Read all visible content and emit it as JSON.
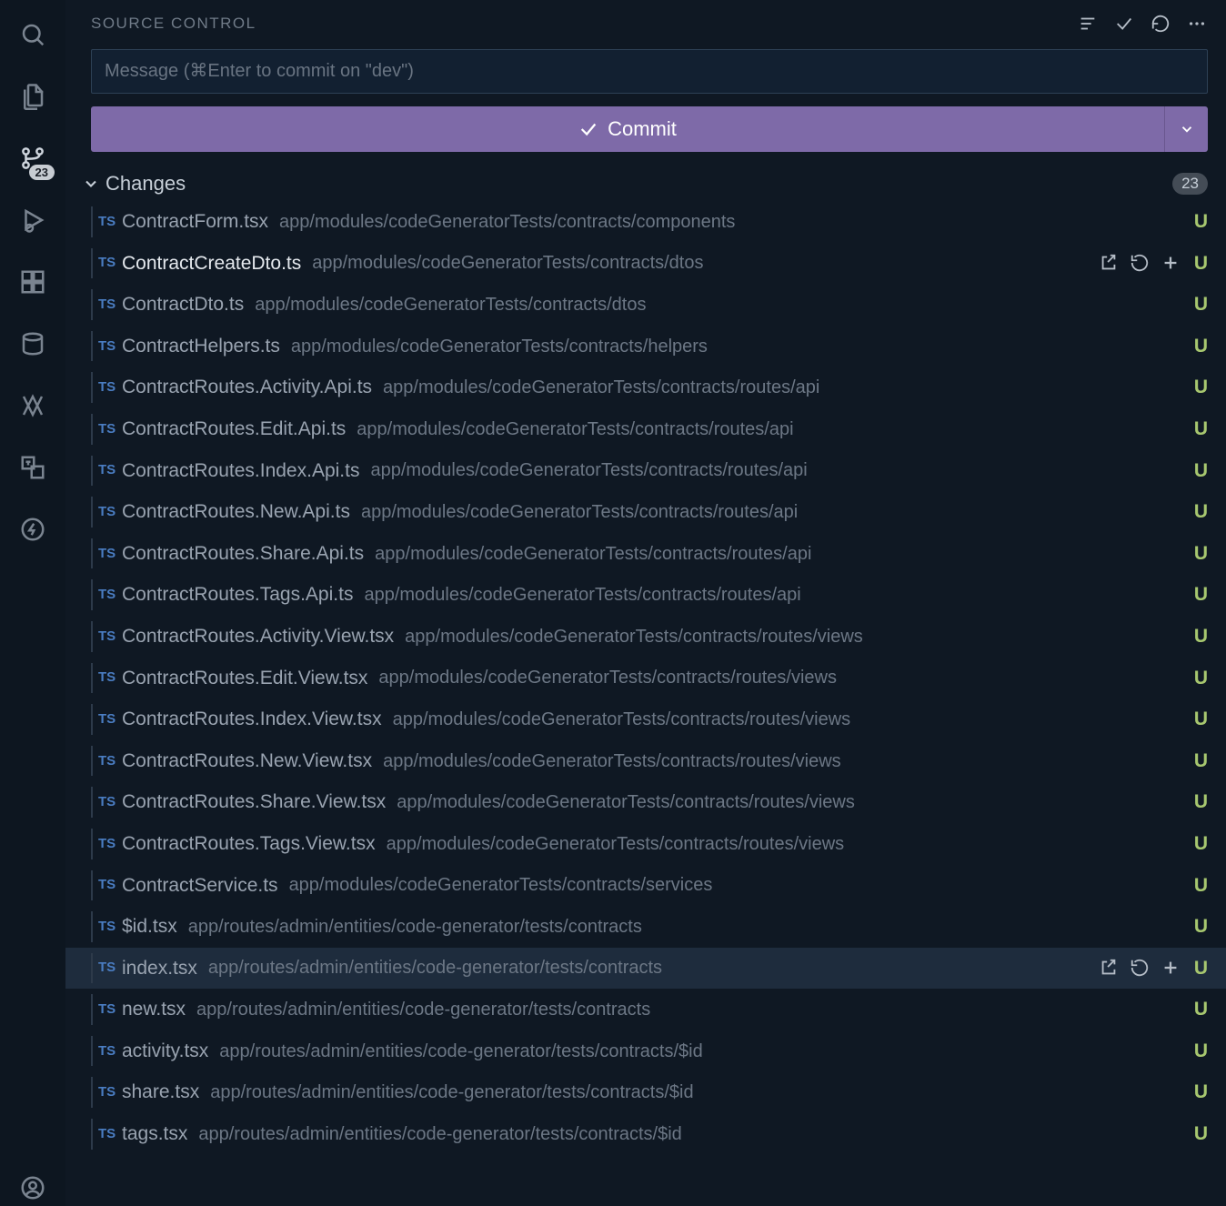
{
  "activity": {
    "scm_badge": "23"
  },
  "header": {
    "title": "SOURCE CONTROL"
  },
  "commit": {
    "placeholder": "Message (⌘Enter to commit on \"dev\")",
    "button_label": "Commit"
  },
  "changes": {
    "label": "Changes",
    "count": "23",
    "ts_badge": "TS",
    "status_letter": "U",
    "items": [
      {
        "name": "ContractForm.tsx",
        "path": "app/modules/codeGeneratorTests/contracts/components",
        "bright": false,
        "actions": false,
        "highlight": false
      },
      {
        "name": "ContractCreateDto.ts",
        "path": "app/modules/codeGeneratorTests/contracts/dtos",
        "bright": true,
        "actions": true,
        "highlight": false
      },
      {
        "name": "ContractDto.ts",
        "path": "app/modules/codeGeneratorTests/contracts/dtos",
        "bright": false,
        "actions": false,
        "highlight": false
      },
      {
        "name": "ContractHelpers.ts",
        "path": "app/modules/codeGeneratorTests/contracts/helpers",
        "bright": false,
        "actions": false,
        "highlight": false
      },
      {
        "name": "ContractRoutes.Activity.Api.ts",
        "path": "app/modules/codeGeneratorTests/contracts/routes/api",
        "bright": false,
        "actions": false,
        "highlight": false
      },
      {
        "name": "ContractRoutes.Edit.Api.ts",
        "path": "app/modules/codeGeneratorTests/contracts/routes/api",
        "bright": false,
        "actions": false,
        "highlight": false
      },
      {
        "name": "ContractRoutes.Index.Api.ts",
        "path": "app/modules/codeGeneratorTests/contracts/routes/api",
        "bright": false,
        "actions": false,
        "highlight": false
      },
      {
        "name": "ContractRoutes.New.Api.ts",
        "path": "app/modules/codeGeneratorTests/contracts/routes/api",
        "bright": false,
        "actions": false,
        "highlight": false
      },
      {
        "name": "ContractRoutes.Share.Api.ts",
        "path": "app/modules/codeGeneratorTests/contracts/routes/api",
        "bright": false,
        "actions": false,
        "highlight": false
      },
      {
        "name": "ContractRoutes.Tags.Api.ts",
        "path": "app/modules/codeGeneratorTests/contracts/routes/api",
        "bright": false,
        "actions": false,
        "highlight": false
      },
      {
        "name": "ContractRoutes.Activity.View.tsx",
        "path": "app/modules/codeGeneratorTests/contracts/routes/views",
        "bright": false,
        "actions": false,
        "highlight": false
      },
      {
        "name": "ContractRoutes.Edit.View.tsx",
        "path": "app/modules/codeGeneratorTests/contracts/routes/views",
        "bright": false,
        "actions": false,
        "highlight": false
      },
      {
        "name": "ContractRoutes.Index.View.tsx",
        "path": "app/modules/codeGeneratorTests/contracts/routes/views",
        "bright": false,
        "actions": false,
        "highlight": false
      },
      {
        "name": "ContractRoutes.New.View.tsx",
        "path": "app/modules/codeGeneratorTests/contracts/routes/views",
        "bright": false,
        "actions": false,
        "highlight": false
      },
      {
        "name": "ContractRoutes.Share.View.tsx",
        "path": "app/modules/codeGeneratorTests/contracts/routes/views",
        "bright": false,
        "actions": false,
        "highlight": false
      },
      {
        "name": "ContractRoutes.Tags.View.tsx",
        "path": "app/modules/codeGeneratorTests/contracts/routes/views",
        "bright": false,
        "actions": false,
        "highlight": false
      },
      {
        "name": "ContractService.ts",
        "path": "app/modules/codeGeneratorTests/contracts/services",
        "bright": false,
        "actions": false,
        "highlight": false
      },
      {
        "name": "$id.tsx",
        "path": "app/routes/admin/entities/code-generator/tests/contracts",
        "bright": false,
        "actions": false,
        "highlight": false
      },
      {
        "name": "index.tsx",
        "path": "app/routes/admin/entities/code-generator/tests/contracts",
        "bright": false,
        "actions": true,
        "highlight": true
      },
      {
        "name": "new.tsx",
        "path": "app/routes/admin/entities/code-generator/tests/contracts",
        "bright": false,
        "actions": false,
        "highlight": false
      },
      {
        "name": "activity.tsx",
        "path": "app/routes/admin/entities/code-generator/tests/contracts/$id",
        "bright": false,
        "actions": false,
        "highlight": false
      },
      {
        "name": "share.tsx",
        "path": "app/routes/admin/entities/code-generator/tests/contracts/$id",
        "bright": false,
        "actions": false,
        "highlight": false
      },
      {
        "name": "tags.tsx",
        "path": "app/routes/admin/entities/code-generator/tests/contracts/$id",
        "bright": false,
        "actions": false,
        "highlight": false
      }
    ]
  }
}
